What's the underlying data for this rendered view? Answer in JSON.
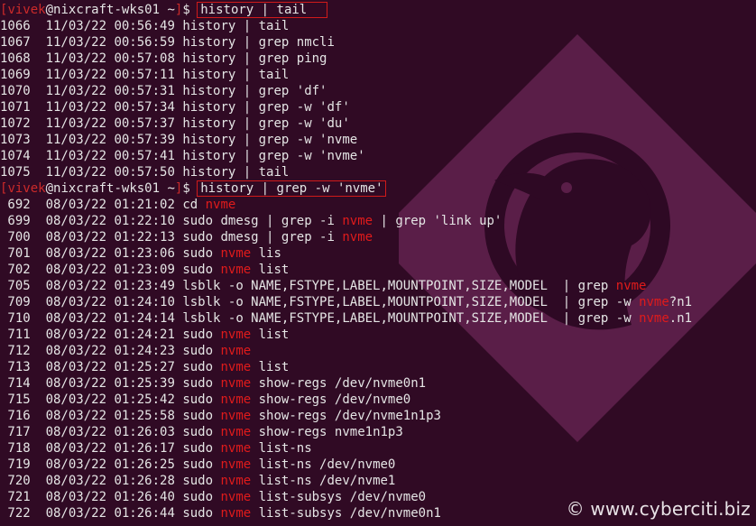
{
  "prompts": [
    {
      "user": "vivek",
      "host": "nixcraft-wks01",
      "dir": "~",
      "symbol": "$",
      "command": "history | tail"
    },
    {
      "user": "vivek",
      "host": "nixcraft-wks01",
      "dir": "~",
      "symbol": "$",
      "command": "history | grep -w 'nvme'"
    }
  ],
  "history_tail": [
    {
      "num": "1066",
      "date": "11/03/22",
      "time": "00:56:49",
      "cmd": [
        {
          "t": "history | tail"
        }
      ]
    },
    {
      "num": "1067",
      "date": "11/03/22",
      "time": "00:56:59",
      "cmd": [
        {
          "t": "history | grep nmcli"
        }
      ]
    },
    {
      "num": "1068",
      "date": "11/03/22",
      "time": "00:57:08",
      "cmd": [
        {
          "t": "history | grep ping"
        }
      ]
    },
    {
      "num": "1069",
      "date": "11/03/22",
      "time": "00:57:11",
      "cmd": [
        {
          "t": "history | tail"
        }
      ]
    },
    {
      "num": "1070",
      "date": "11/03/22",
      "time": "00:57:31",
      "cmd": [
        {
          "t": "history | grep 'df'"
        }
      ]
    },
    {
      "num": "1071",
      "date": "11/03/22",
      "time": "00:57:34",
      "cmd": [
        {
          "t": "history | grep -w 'df'"
        }
      ]
    },
    {
      "num": "1072",
      "date": "11/03/22",
      "time": "00:57:37",
      "cmd": [
        {
          "t": "history | grep -w 'du'"
        }
      ]
    },
    {
      "num": "1073",
      "date": "11/03/22",
      "time": "00:57:39",
      "cmd": [
        {
          "t": "history | grep -w 'nvme"
        }
      ]
    },
    {
      "num": "1074",
      "date": "11/03/22",
      "time": "00:57:41",
      "cmd": [
        {
          "t": "history | grep -w 'nvme'"
        }
      ]
    },
    {
      "num": "1075",
      "date": "11/03/22",
      "time": "00:57:50",
      "cmd": [
        {
          "t": "history | tail"
        }
      ]
    }
  ],
  "history_grep": [
    {
      "num": " 692",
      "date": "08/03/22",
      "time": "01:21:02",
      "cmd": [
        {
          "t": "cd "
        },
        {
          "t": "nvme",
          "hl": true
        }
      ]
    },
    {
      "num": " 699",
      "date": "08/03/22",
      "time": "01:22:10",
      "cmd": [
        {
          "t": "sudo dmesg | grep -i "
        },
        {
          "t": "nvme",
          "hl": true
        },
        {
          "t": " | grep 'link up'"
        }
      ]
    },
    {
      "num": " 700",
      "date": "08/03/22",
      "time": "01:22:13",
      "cmd": [
        {
          "t": "sudo dmesg | grep -i "
        },
        {
          "t": "nvme",
          "hl": true
        }
      ]
    },
    {
      "num": " 701",
      "date": "08/03/22",
      "time": "01:23:06",
      "cmd": [
        {
          "t": "sudo "
        },
        {
          "t": "nvme",
          "hl": true
        },
        {
          "t": " lis"
        }
      ]
    },
    {
      "num": " 702",
      "date": "08/03/22",
      "time": "01:23:09",
      "cmd": [
        {
          "t": "sudo "
        },
        {
          "t": "nvme",
          "hl": true
        },
        {
          "t": " list"
        }
      ]
    },
    {
      "num": " 705",
      "date": "08/03/22",
      "time": "01:23:49",
      "cmd": [
        {
          "t": "lsblk -o NAME,FSTYPE,LABEL,MOUNTPOINT,SIZE,MODEL  | grep "
        },
        {
          "t": "nvme",
          "hl": true
        }
      ]
    },
    {
      "num": " 709",
      "date": "08/03/22",
      "time": "01:24:10",
      "cmd": [
        {
          "t": "lsblk -o NAME,FSTYPE,LABEL,MOUNTPOINT,SIZE,MODEL  | grep -w "
        },
        {
          "t": "nvme",
          "hl": true
        },
        {
          "t": "?n1"
        }
      ]
    },
    {
      "num": " 710",
      "date": "08/03/22",
      "time": "01:24:14",
      "cmd": [
        {
          "t": "lsblk -o NAME,FSTYPE,LABEL,MOUNTPOINT,SIZE,MODEL  | grep -w "
        },
        {
          "t": "nvme",
          "hl": true
        },
        {
          "t": ".n1"
        }
      ]
    },
    {
      "num": " 711",
      "date": "08/03/22",
      "time": "01:24:21",
      "cmd": [
        {
          "t": "sudo "
        },
        {
          "t": "nvme",
          "hl": true
        },
        {
          "t": " list"
        }
      ]
    },
    {
      "num": " 712",
      "date": "08/03/22",
      "time": "01:24:23",
      "cmd": [
        {
          "t": "sudo "
        },
        {
          "t": "nvme",
          "hl": true
        }
      ]
    },
    {
      "num": " 713",
      "date": "08/03/22",
      "time": "01:25:27",
      "cmd": [
        {
          "t": "sudo "
        },
        {
          "t": "nvme",
          "hl": true
        },
        {
          "t": " list"
        }
      ]
    },
    {
      "num": " 714",
      "date": "08/03/22",
      "time": "01:25:39",
      "cmd": [
        {
          "t": "sudo "
        },
        {
          "t": "nvme",
          "hl": true
        },
        {
          "t": " show-regs /dev/nvme0n1"
        }
      ]
    },
    {
      "num": " 715",
      "date": "08/03/22",
      "time": "01:25:42",
      "cmd": [
        {
          "t": "sudo "
        },
        {
          "t": "nvme",
          "hl": true
        },
        {
          "t": " show-regs /dev/nvme0"
        }
      ]
    },
    {
      "num": " 716",
      "date": "08/03/22",
      "time": "01:25:58",
      "cmd": [
        {
          "t": "sudo "
        },
        {
          "t": "nvme",
          "hl": true
        },
        {
          "t": " show-regs /dev/nvme1n1p3"
        }
      ]
    },
    {
      "num": " 717",
      "date": "08/03/22",
      "time": "01:26:03",
      "cmd": [
        {
          "t": "sudo "
        },
        {
          "t": "nvme",
          "hl": true
        },
        {
          "t": " show-regs nvme1n1p3"
        }
      ]
    },
    {
      "num": " 718",
      "date": "08/03/22",
      "time": "01:26:17",
      "cmd": [
        {
          "t": "sudo "
        },
        {
          "t": "nvme",
          "hl": true
        },
        {
          "t": " list-ns"
        }
      ]
    },
    {
      "num": " 719",
      "date": "08/03/22",
      "time": "01:26:25",
      "cmd": [
        {
          "t": "sudo "
        },
        {
          "t": "nvme",
          "hl": true
        },
        {
          "t": " list-ns /dev/nvme0"
        }
      ]
    },
    {
      "num": " 720",
      "date": "08/03/22",
      "time": "01:26:28",
      "cmd": [
        {
          "t": "sudo "
        },
        {
          "t": "nvme",
          "hl": true
        },
        {
          "t": " list-ns /dev/nvme1"
        }
      ]
    },
    {
      "num": " 721",
      "date": "08/03/22",
      "time": "01:26:40",
      "cmd": [
        {
          "t": "sudo "
        },
        {
          "t": "nvme",
          "hl": true
        },
        {
          "t": " list-subsys /dev/nvme0"
        }
      ]
    },
    {
      "num": " 722",
      "date": "08/03/22",
      "time": "01:26:44",
      "cmd": [
        {
          "t": "sudo "
        },
        {
          "t": "nvme",
          "hl": true
        },
        {
          "t": " list-subsys /dev/nvme0n1"
        }
      ]
    }
  ],
  "watermark": {
    "icon": "tux-penguin-icon",
    "copyright": "© www.cyberciti.biz"
  },
  "colors": {
    "background": "#300a24",
    "text": "#e5e5e5",
    "highlight": "#e01b1b",
    "box": "#d01a1a",
    "watermark": "#6a2a58"
  }
}
